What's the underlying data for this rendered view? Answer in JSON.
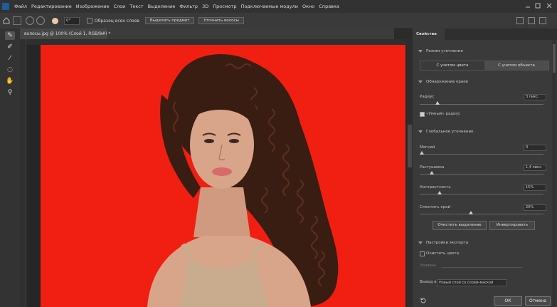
{
  "menubar": {
    "items": [
      "Файл",
      "Редактирование",
      "Изображение",
      "Слои",
      "Текст",
      "Выделение",
      "Фильтр",
      "3D",
      "Просмотр",
      "Подключаемые модули",
      "Окно",
      "Справка"
    ]
  },
  "options_bar": {
    "size_value": "0°",
    "sample_all_layers": "Образец всех слоев",
    "select_subject": "Выделить предмет",
    "refine_hair": "Уточнить волосы"
  },
  "document_tab": {
    "title": "волосы.jpg @ 100% (Слой 1, RGB/8#) *"
  },
  "properties": {
    "tab_title": "Свойства",
    "refine_mode": {
      "heading": "Режим уточнения",
      "option_color": "С учетом цвета",
      "option_object": "С учетом объекта",
      "selected": "С учетом объекта"
    },
    "edge_detection": {
      "heading": "Обнаружение краев",
      "radius_label": "Радиус",
      "radius_value": "3 пикс.",
      "smart_radius_label": "«Умный» радиус",
      "smart_radius_checked": true
    },
    "global_refinements": {
      "heading": "Глобальное уточнение",
      "smooth_label": "Мягкий",
      "smooth_value": "0",
      "feather_label": "Растушевка",
      "feather_value": "1,4 пикс.",
      "contrast_label": "Контрастность",
      "contrast_value": "15%",
      "shift_edge_label": "Сместить край",
      "shift_edge_value": "20%",
      "clear_selection_button": "Очистить выделение",
      "invert_button": "Инвертировать"
    },
    "output_settings": {
      "heading": "Настройки экспорта",
      "decontaminate_label": "Очистить цвета",
      "amount_label": "Уровень",
      "output_to_label": "Вывод в",
      "output_to_value": "Новый слой со слоем-маской"
    },
    "ok_button": "ОК",
    "cancel_button": "Отмена"
  },
  "colors": {
    "canvas_background": "#f01f12",
    "hair": "#3a1d12",
    "skin": "#d9a58a",
    "top": "#c9ab8e"
  }
}
